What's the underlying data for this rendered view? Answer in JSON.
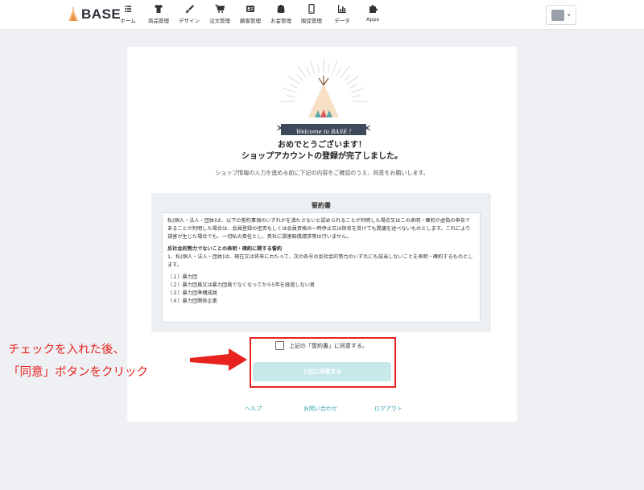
{
  "header": {
    "logo_text": "BASE",
    "nav": [
      {
        "label": "ホーム",
        "icon": "home-icon"
      },
      {
        "label": "商品管理",
        "icon": "shirt-icon"
      },
      {
        "label": "デザイン",
        "icon": "brush-icon"
      },
      {
        "label": "注文管理",
        "icon": "cart-icon"
      },
      {
        "label": "顧客管理",
        "icon": "customer-icon"
      },
      {
        "label": "お金管理",
        "icon": "wallet-icon"
      },
      {
        "label": "販促管理",
        "icon": "phone-icon"
      },
      {
        "label": "データ",
        "icon": "chart-icon"
      },
      {
        "label": "Apps",
        "icon": "puzzle-icon"
      }
    ],
    "store_menu_icon": "store-icon"
  },
  "hero": {
    "welcome_banner": "Welcome to  BASE !"
  },
  "title_line1": "おめでとうございます！",
  "title_line2": "ショップアカウントの登録が完了しました。",
  "subtitle": "ショップ情報の入力を進める前に下記の内容をご確認のうえ、同意をお願いします。",
  "terms": {
    "title": "誓約書",
    "intro": "私(個人・法人・団体)は、以下の誓約事項のいずれかを満たさないと認められることが判明した場合又はこの表明・確約が虚偽の申告であることが判明した場合は、会員登録の拒否もしくは会員資格の一時停止又は除名を受けても異議を述べないものとします。これにより損害が生じた場合でも、一切私の責任とし、貴社に損害賠償請求等は行いません。",
    "section_title": "反社会的勢力でないことの表明・確約に関する誓約",
    "section_body": "1．私(個人・法人・団体)は、現在又は将来にわたって、次の各号の反社会的勢力のいずれにも該当しないことを表明・確約するものとします。",
    "items": [
      "（１）暴力団",
      "（２）暴力団員又は暴力団員でなくなってから5年を経過しない者",
      "（３）暴力団準構成員",
      "（４）暴力団関係企業"
    ]
  },
  "agree_checkbox_label": "上記の「誓約書」に同意する。",
  "agree_button_label": "上記に同意する",
  "footer": {
    "help": "ヘルプ",
    "contact": "お問い合わせ",
    "logout": "ログアウト"
  },
  "annotation": {
    "line1": "チェックを入れた後、",
    "line2": "「同意」ボタンをクリック"
  },
  "colors": {
    "accent_teal": "#3aa5a8",
    "button_disabled": "#c7e9ea",
    "annotation_red": "#e8231f",
    "banner_navy": "#3d4a5c"
  }
}
